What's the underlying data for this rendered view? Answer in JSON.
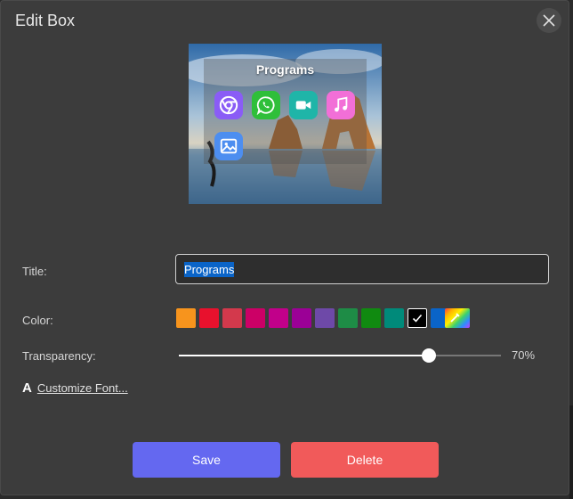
{
  "dialog": {
    "title": "Edit Box"
  },
  "preview": {
    "box_title": "Programs",
    "apps": [
      {
        "icon": "chrome-icon",
        "color": "#8a5cf6"
      },
      {
        "icon": "whatsapp-icon",
        "color": "#2fbf3a"
      },
      {
        "icon": "video-camera-icon",
        "color": "#1fb5a8"
      },
      {
        "icon": "music-note-icon",
        "color": "#f26fd7"
      },
      {
        "icon": "image-icon",
        "color": "#4d8ef0"
      }
    ]
  },
  "form": {
    "title_label": "Title:",
    "title_value": "Programs",
    "color_label": "Color:",
    "colors": [
      "#f7941d",
      "#e8112d",
      "#d3394c",
      "#cc0066",
      "#c1008a",
      "#9b0096",
      "#6e49a8",
      "#1e8c46",
      "#108a10",
      "#008a7a",
      "#000000",
      "#0a64c8"
    ],
    "selected_color_index": 10,
    "custom_color_icon": "color-picker-icon",
    "transparency_label": "Transparency:",
    "transparency_percent": 70,
    "transparency_text": "70%",
    "customize_font_icon": "A",
    "customize_font_label": "Customize Font..."
  },
  "buttons": {
    "save": "Save",
    "delete": "Delete"
  },
  "accent": {
    "save": "#6468f0",
    "delete": "#f15a5a"
  }
}
